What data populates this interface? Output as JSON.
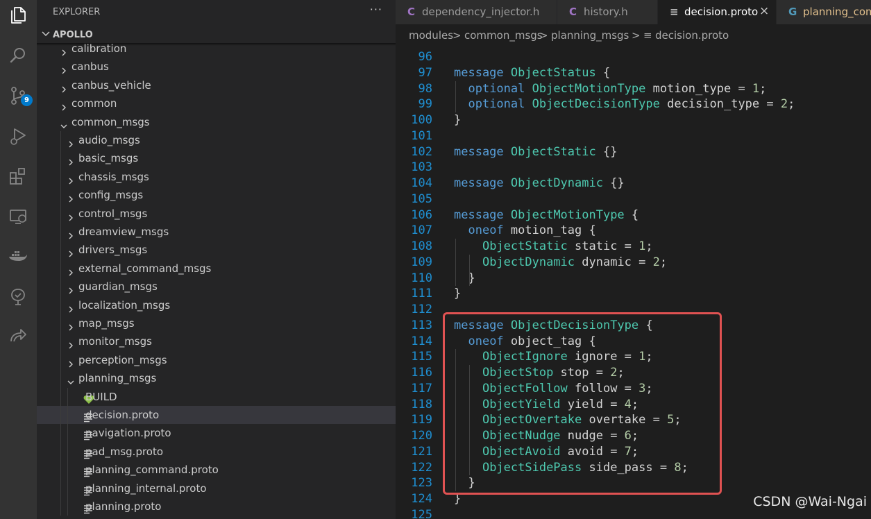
{
  "explorer": {
    "title": "EXPLORER",
    "more": "···",
    "root": "APOLLO",
    "items": [
      {
        "label": "calibration",
        "kind": "folder",
        "open": false
      },
      {
        "label": "canbus",
        "kind": "folder",
        "open": false
      },
      {
        "label": "canbus_vehicle",
        "kind": "folder",
        "open": false
      },
      {
        "label": "common",
        "kind": "folder",
        "open": false
      },
      {
        "label": "common_msgs",
        "kind": "folder",
        "open": true
      },
      {
        "label": "audio_msgs",
        "kind": "folder",
        "open": false
      },
      {
        "label": "basic_msgs",
        "kind": "folder",
        "open": false
      },
      {
        "label": "chassis_msgs",
        "kind": "folder",
        "open": false
      },
      {
        "label": "config_msgs",
        "kind": "folder",
        "open": false
      },
      {
        "label": "control_msgs",
        "kind": "folder",
        "open": false
      },
      {
        "label": "dreamview_msgs",
        "kind": "folder",
        "open": false
      },
      {
        "label": "drivers_msgs",
        "kind": "folder",
        "open": false
      },
      {
        "label": "external_command_msgs",
        "kind": "folder",
        "open": false
      },
      {
        "label": "guardian_msgs",
        "kind": "folder",
        "open": false
      },
      {
        "label": "localization_msgs",
        "kind": "folder",
        "open": false
      },
      {
        "label": "map_msgs",
        "kind": "folder",
        "open": false
      },
      {
        "label": "monitor_msgs",
        "kind": "folder",
        "open": false
      },
      {
        "label": "perception_msgs",
        "kind": "folder",
        "open": false
      },
      {
        "label": "planning_msgs",
        "kind": "folder",
        "open": true
      },
      {
        "label": "BUILD",
        "kind": "build"
      },
      {
        "label": "decision.proto",
        "kind": "file",
        "selected": true
      },
      {
        "label": "navigation.proto",
        "kind": "file"
      },
      {
        "label": "pad_msg.proto",
        "kind": "file"
      },
      {
        "label": "planning_command.proto",
        "kind": "file"
      },
      {
        "label": "planning_internal.proto",
        "kind": "file"
      },
      {
        "label": "planning.proto",
        "kind": "file"
      }
    ]
  },
  "activity_bar": {
    "icons": [
      "files-icon",
      "search-icon",
      "source-control-icon",
      "run-debug-icon",
      "extensions-icon",
      "remote-explorer-icon",
      "docker-icon",
      "testing-icon",
      "live-share-icon"
    ],
    "source_control_badge": "9"
  },
  "tabs": [
    {
      "label": "dependency_injector.h",
      "icon": "C",
      "icon_color": "#a074c4",
      "active": false
    },
    {
      "label": "history.h",
      "icon": "C",
      "icon_color": "#a074c4",
      "active": false
    },
    {
      "label": "decision.proto",
      "icon": "≡",
      "icon_color": "#cccccc",
      "active": true,
      "close": "×"
    },
    {
      "label": "planning_com",
      "icon": "G",
      "icon_color": "#519aba",
      "active": false
    }
  ],
  "breadcrumb": [
    "modules",
    "common_msgs",
    "planning_msgs",
    "decision.proto"
  ],
  "breadcrumb_sep": ">",
  "breadcrumb_file_icon": "≡",
  "code": [
    {
      "n": "96",
      "tokens": []
    },
    {
      "n": "97",
      "tokens": [
        [
          "kw",
          "message"
        ],
        [
          "id",
          " "
        ],
        [
          "ty",
          "ObjectStatus"
        ],
        [
          "id",
          " {"
        ]
      ]
    },
    {
      "n": "98",
      "tokens": [
        [
          "id",
          "  "
        ],
        [
          "kw",
          "optional"
        ],
        [
          "id",
          " "
        ],
        [
          "ty",
          "ObjectMotionType"
        ],
        [
          "id",
          " motion_type = "
        ],
        [
          "nu",
          "1"
        ],
        [
          "id",
          ";"
        ]
      ]
    },
    {
      "n": "99",
      "tokens": [
        [
          "id",
          "  "
        ],
        [
          "kw",
          "optional"
        ],
        [
          "id",
          " "
        ],
        [
          "ty",
          "ObjectDecisionType"
        ],
        [
          "id",
          " decision_type = "
        ],
        [
          "nu",
          "2"
        ],
        [
          "id",
          ";"
        ]
      ]
    },
    {
      "n": "100",
      "tokens": [
        [
          "id",
          "}"
        ]
      ]
    },
    {
      "n": "101",
      "tokens": []
    },
    {
      "n": "102",
      "tokens": [
        [
          "kw",
          "message"
        ],
        [
          "id",
          " "
        ],
        [
          "ty",
          "ObjectStatic"
        ],
        [
          "id",
          " {}"
        ]
      ]
    },
    {
      "n": "103",
      "tokens": []
    },
    {
      "n": "104",
      "tokens": [
        [
          "kw",
          "message"
        ],
        [
          "id",
          " "
        ],
        [
          "ty",
          "ObjectDynamic"
        ],
        [
          "id",
          " {}"
        ]
      ]
    },
    {
      "n": "105",
      "tokens": []
    },
    {
      "n": "106",
      "tokens": [
        [
          "kw",
          "message"
        ],
        [
          "id",
          " "
        ],
        [
          "ty",
          "ObjectMotionType"
        ],
        [
          "id",
          " {"
        ]
      ]
    },
    {
      "n": "107",
      "tokens": [
        [
          "id",
          "  "
        ],
        [
          "kw",
          "oneof"
        ],
        [
          "id",
          " motion_tag {"
        ]
      ]
    },
    {
      "n": "108",
      "tokens": [
        [
          "id",
          "    "
        ],
        [
          "ty",
          "ObjectStatic"
        ],
        [
          "id",
          " static = "
        ],
        [
          "nu",
          "1"
        ],
        [
          "id",
          ";"
        ]
      ]
    },
    {
      "n": "109",
      "tokens": [
        [
          "id",
          "    "
        ],
        [
          "ty",
          "ObjectDynamic"
        ],
        [
          "id",
          " dynamic = "
        ],
        [
          "nu",
          "2"
        ],
        [
          "id",
          ";"
        ]
      ]
    },
    {
      "n": "110",
      "tokens": [
        [
          "id",
          "  }"
        ]
      ]
    },
    {
      "n": "111",
      "tokens": [
        [
          "id",
          "}"
        ]
      ]
    },
    {
      "n": "112",
      "tokens": []
    },
    {
      "n": "113",
      "tokens": [
        [
          "kw",
          "message"
        ],
        [
          "id",
          " "
        ],
        [
          "ty",
          "ObjectDecisionType"
        ],
        [
          "id",
          " {"
        ]
      ]
    },
    {
      "n": "114",
      "tokens": [
        [
          "id",
          "  "
        ],
        [
          "kw",
          "oneof"
        ],
        [
          "id",
          " object_tag {"
        ]
      ]
    },
    {
      "n": "115",
      "tokens": [
        [
          "id",
          "    "
        ],
        [
          "ty",
          "ObjectIgnore"
        ],
        [
          "id",
          " ignore = "
        ],
        [
          "nu",
          "1"
        ],
        [
          "id",
          ";"
        ]
      ]
    },
    {
      "n": "116",
      "tokens": [
        [
          "id",
          "    "
        ],
        [
          "ty",
          "ObjectStop"
        ],
        [
          "id",
          " stop = "
        ],
        [
          "nu",
          "2"
        ],
        [
          "id",
          ";"
        ]
      ]
    },
    {
      "n": "117",
      "tokens": [
        [
          "id",
          "    "
        ],
        [
          "ty",
          "ObjectFollow"
        ],
        [
          "id",
          " follow = "
        ],
        [
          "nu",
          "3"
        ],
        [
          "id",
          ";"
        ]
      ]
    },
    {
      "n": "118",
      "tokens": [
        [
          "id",
          "    "
        ],
        [
          "ty",
          "ObjectYield"
        ],
        [
          "id",
          " yield = "
        ],
        [
          "nu",
          "4"
        ],
        [
          "id",
          ";"
        ]
      ]
    },
    {
      "n": "119",
      "tokens": [
        [
          "id",
          "    "
        ],
        [
          "ty",
          "ObjectOvertake"
        ],
        [
          "id",
          " overtake = "
        ],
        [
          "nu",
          "5"
        ],
        [
          "id",
          ";"
        ]
      ]
    },
    {
      "n": "120",
      "tokens": [
        [
          "id",
          "    "
        ],
        [
          "ty",
          "ObjectNudge"
        ],
        [
          "id",
          " nudge = "
        ],
        [
          "nu",
          "6"
        ],
        [
          "id",
          ";"
        ]
      ]
    },
    {
      "n": "121",
      "tokens": [
        [
          "id",
          "    "
        ],
        [
          "ty",
          "ObjectAvoid"
        ],
        [
          "id",
          " avoid = "
        ],
        [
          "nu",
          "7"
        ],
        [
          "id",
          ";"
        ]
      ]
    },
    {
      "n": "122",
      "tokens": [
        [
          "id",
          "    "
        ],
        [
          "ty",
          "ObjectSidePass"
        ],
        [
          "id",
          " side_pass = "
        ],
        [
          "nu",
          "8"
        ],
        [
          "id",
          ";"
        ]
      ]
    },
    {
      "n": "123",
      "tokens": [
        [
          "id",
          "  }"
        ]
      ]
    },
    {
      "n": "124",
      "tokens": [
        [
          "id",
          "}"
        ]
      ]
    },
    {
      "n": "125",
      "tokens": []
    }
  ],
  "watermark": "CSDN @Wai-Ngai",
  "colors": {
    "accent": "#007acc",
    "highlight_border": "#e05252",
    "keyword": "#569cd6",
    "type": "#4ec9b0",
    "number": "#b5cea8",
    "line_number": "#1f8fd1",
    "build_icon": "#8dc149"
  }
}
